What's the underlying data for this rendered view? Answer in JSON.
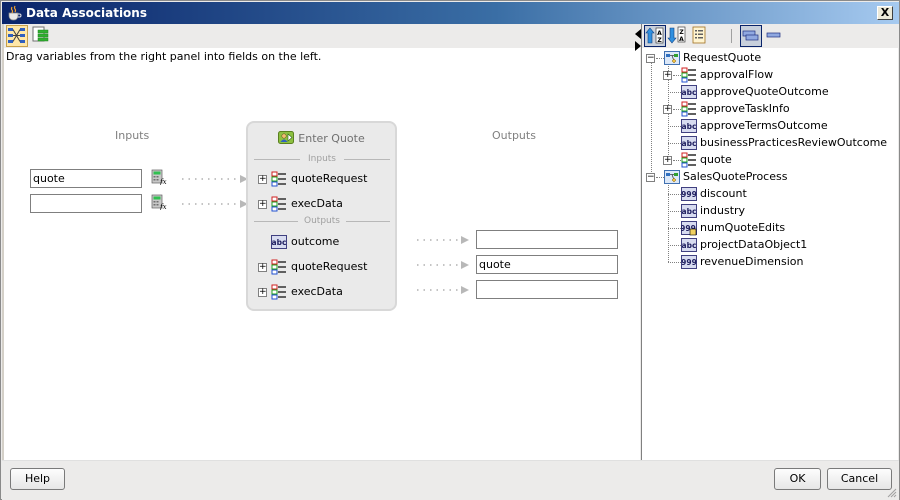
{
  "window": {
    "title": "Data Associations",
    "close_label": "X"
  },
  "left_panel": {
    "toolbar": {
      "buttons": [
        {
          "name": "visual-mapping-mode",
          "active": true
        },
        {
          "name": "copy-rules-mode",
          "active": false
        }
      ]
    },
    "hint": "Drag variables from the right panel into fields on the left.",
    "inputs_header": "Inputs",
    "outputs_header": "Outputs",
    "input_fields": [
      {
        "value": "quote",
        "placeholder": ""
      },
      {
        "value": "",
        "placeholder": ""
      }
    ],
    "output_fields": [
      {
        "value": "",
        "placeholder": ""
      },
      {
        "value": "quote",
        "placeholder": ""
      },
      {
        "value": "",
        "placeholder": ""
      }
    ],
    "activity": {
      "title": "Enter Quote",
      "inputs_label": "Inputs",
      "outputs_label": "Outputs",
      "inputs": [
        {
          "label": "quoteRequest",
          "type": "complex",
          "expandable": true
        },
        {
          "label": "execData",
          "type": "complex",
          "expandable": true
        }
      ],
      "outputs": [
        {
          "label": "outcome",
          "type": "string",
          "expandable": false
        },
        {
          "label": "quoteRequest",
          "type": "complex",
          "expandable": true
        },
        {
          "label": "execData",
          "type": "complex",
          "expandable": true
        }
      ]
    }
  },
  "right_panel": {
    "toolbar": {
      "buttons": [
        {
          "name": "sort-ascending",
          "active": true
        },
        {
          "name": "sort-descending",
          "active": false
        },
        {
          "name": "list-view",
          "active": false
        },
        {
          "name": "show-all-scopes",
          "active": true
        },
        {
          "name": "collapse",
          "active": false
        }
      ]
    },
    "tree": [
      {
        "label": "RequestQuote",
        "type": "process",
        "expanded": true,
        "children": [
          {
            "label": "approvalFlow",
            "type": "complex",
            "expandable": true
          },
          {
            "label": "approveQuoteOutcome",
            "type": "string",
            "expandable": false
          },
          {
            "label": "approveTaskInfo",
            "type": "complex",
            "expandable": true
          },
          {
            "label": "approveTermsOutcome",
            "type": "string",
            "expandable": false
          },
          {
            "label": "businessPracticesReviewOutcome",
            "type": "string",
            "expandable": false
          },
          {
            "label": "quote",
            "type": "complex",
            "expandable": true
          }
        ]
      },
      {
        "label": "SalesQuoteProcess",
        "type": "process",
        "expanded": true,
        "children": [
          {
            "label": "discount",
            "type": "number",
            "expandable": false
          },
          {
            "label": "industry",
            "type": "string",
            "expandable": false
          },
          {
            "label": "numQuoteEdits",
            "type": "number-locked",
            "expandable": false
          },
          {
            "label": "projectDataObject1",
            "type": "string",
            "expandable": false
          },
          {
            "label": "revenueDimension",
            "type": "number",
            "expandable": false
          }
        ]
      }
    ]
  },
  "footer": {
    "help_label": "Help",
    "ok_label": "OK",
    "cancel_label": "Cancel"
  },
  "colors": {
    "title_gradient_start": "#0A246A",
    "title_gradient_end": "#A6CAF0",
    "dialog_bg": "#ECEBEA",
    "activity_bg": "#EAEAEA",
    "muted_text": "#808080"
  }
}
